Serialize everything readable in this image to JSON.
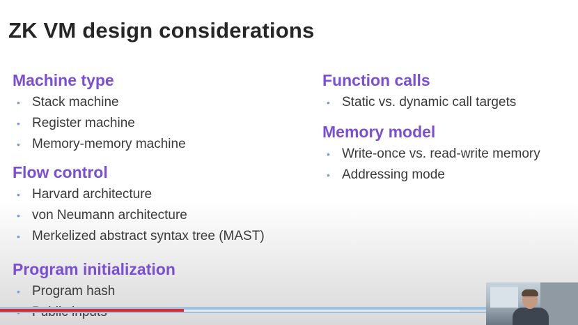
{
  "slide": {
    "title": "ZK VM design considerations",
    "accent_color": "#7a4fd6",
    "bullet_color": "#7aa0c8",
    "sections": [
      {
        "heading": "Machine type",
        "items": [
          "Stack machine",
          "Register machine",
          "Memory-memory machine"
        ]
      },
      {
        "heading": "Flow control",
        "items": [
          "Harvard architecture",
          "von Neumann architecture",
          "Merkelized abstract syntax tree (MAST)"
        ]
      },
      {
        "heading": "Program initialization",
        "items": [
          "Program hash",
          "Public inputs"
        ]
      },
      {
        "heading": "Function calls",
        "items": [
          "Static vs. dynamic call targets"
        ]
      },
      {
        "heading": "Memory model",
        "items": [
          "Write-once vs. read-write memory",
          "Addressing mode"
        ]
      }
    ],
    "bullet_glyph": "•"
  },
  "video": {
    "progress_color": "#e8262a",
    "buffer_color": "#9cc3e3",
    "progress_fraction": 0.32
  }
}
